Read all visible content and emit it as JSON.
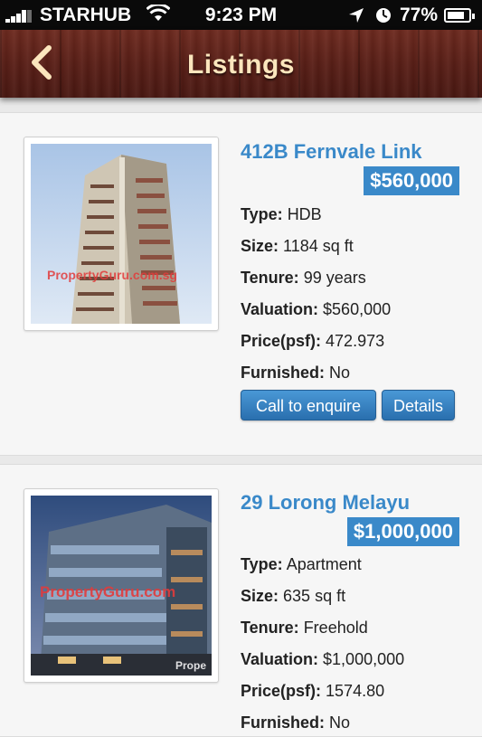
{
  "status_bar": {
    "carrier": "STARHUB",
    "time": "9:23 PM",
    "battery": "77%",
    "icons": [
      "signal-icon",
      "wifi-icon",
      "location-arrow-icon",
      "alarm-clock-icon",
      "battery-icon"
    ]
  },
  "nav": {
    "title": "Listings",
    "back_icon": "chevron-left-icon"
  },
  "labels": {
    "type": "Type:",
    "size": "Size:",
    "tenure": "Tenure:",
    "valuation": "Valuation:",
    "price_psf": "Price(psf):",
    "furnished": "Furnished:"
  },
  "listings": [
    {
      "title": "412B Fernvale Link",
      "price": "$560,000",
      "type": "HDB",
      "size": "1184 sq ft",
      "tenure": "99 years",
      "valuation": "$560,000",
      "price_psf": "472.973",
      "furnished": "No",
      "watermark": "PropertyGuru.com.sg",
      "call_label": "Call to enquire",
      "details_label": "Details"
    },
    {
      "title": "29 Lorong Melayu",
      "price": "$1,000,000",
      "type": "Apartment",
      "size": "635 sq ft",
      "tenure": "Freehold",
      "valuation": "$1,000,000",
      "price_psf": "1574.80",
      "furnished": "No",
      "watermark": "PropertyGuru.com",
      "watermark2": "Prope"
    }
  ],
  "colors": {
    "accent": "#3a89c9",
    "nav_title": "#fbe6bd",
    "nav_wood": "#5a1f17"
  }
}
